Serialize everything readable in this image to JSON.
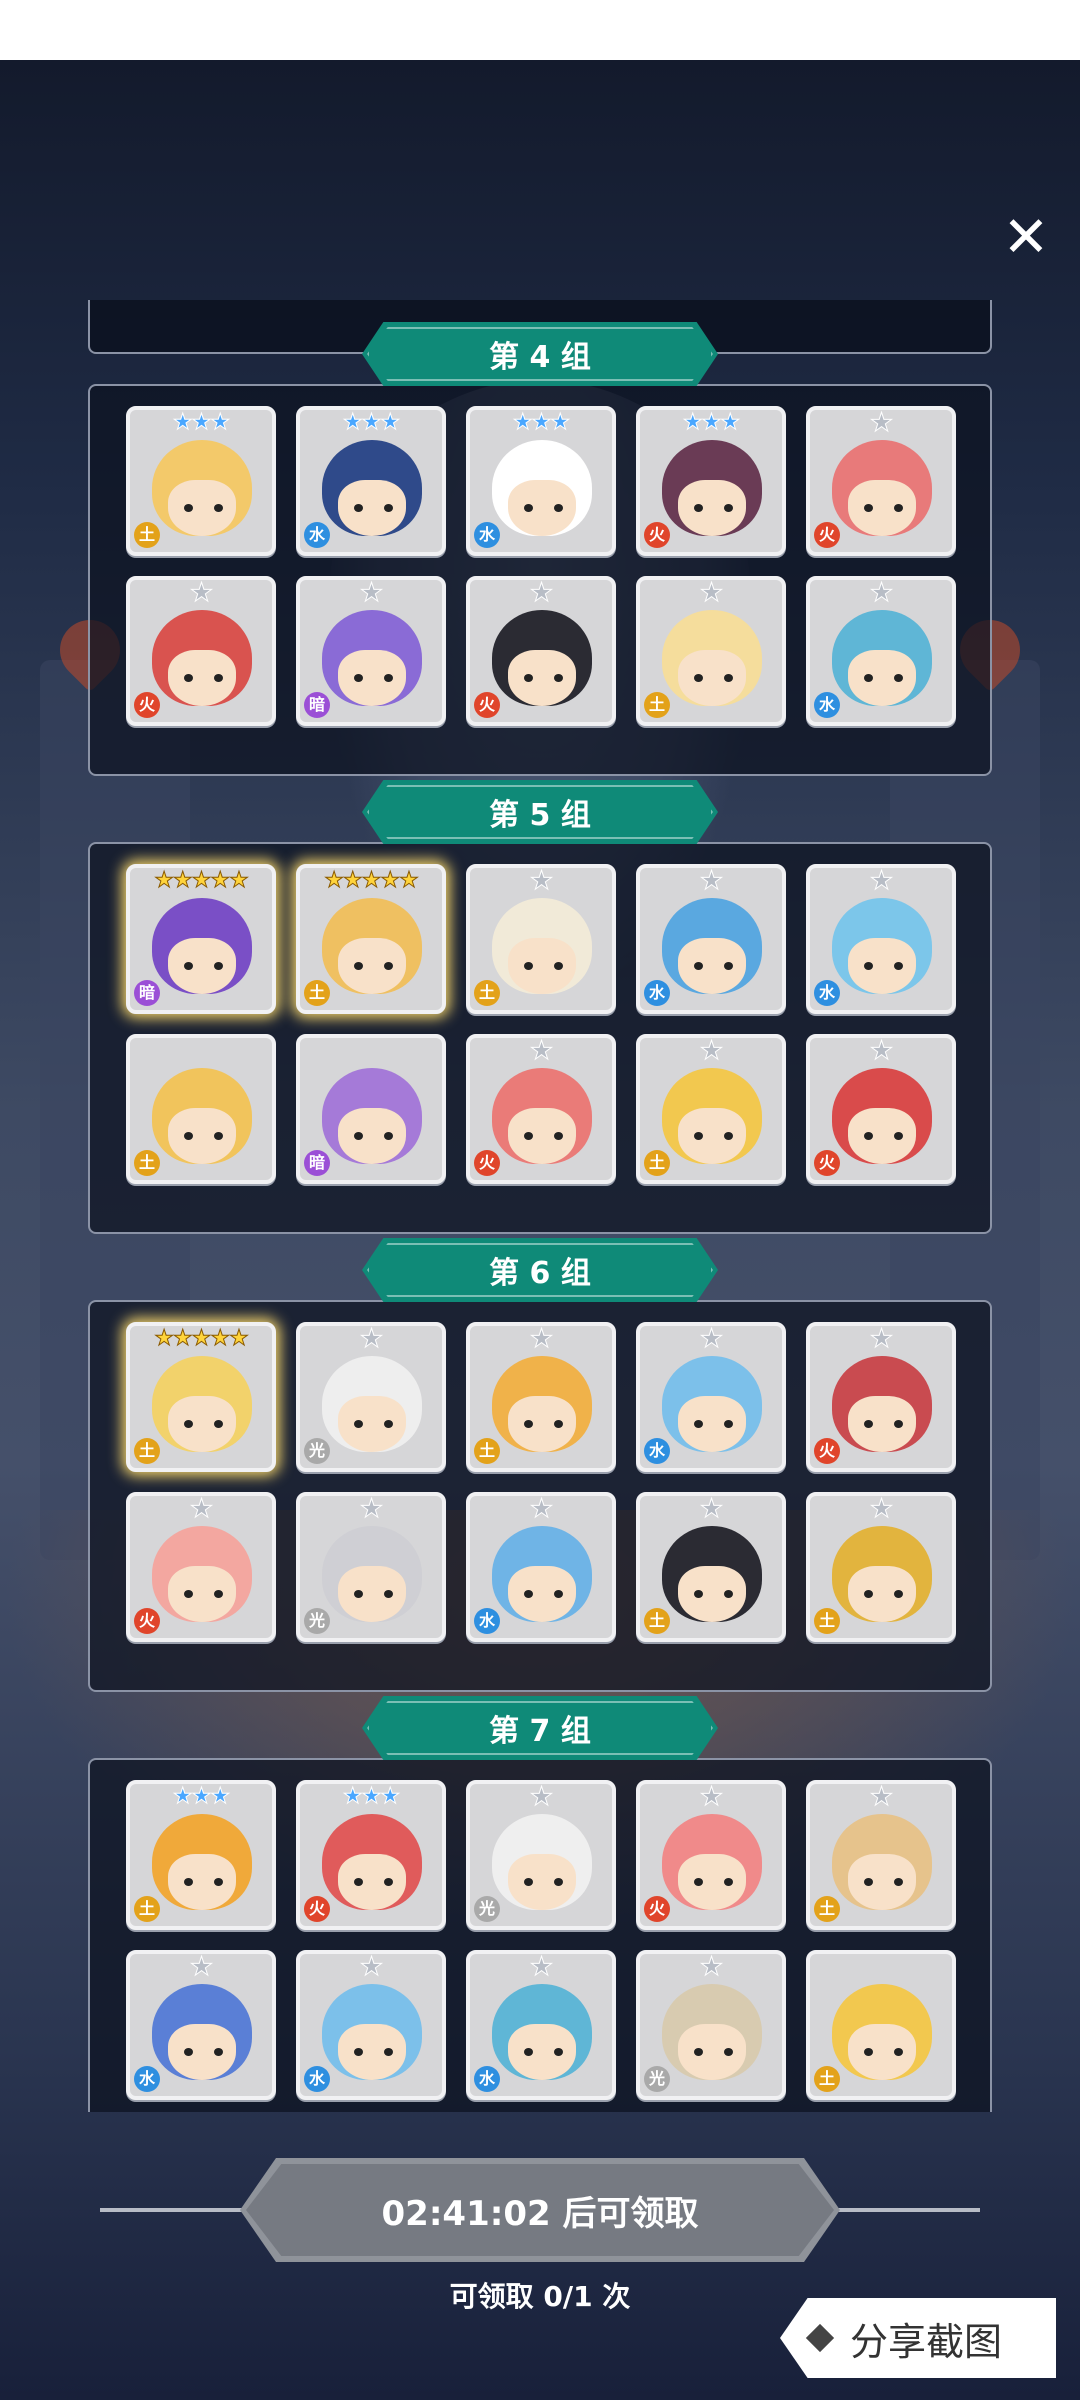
{
  "dialog": {
    "close_icon": "close-icon"
  },
  "groups": [
    {
      "title": "第 4 组",
      "heroes": [
        {
          "stars": "★★★",
          "star_type": "blue",
          "element": "earth",
          "head": "#f3c96a"
        },
        {
          "stars": "★★★",
          "star_type": "blue",
          "element": "water",
          "head": "#2f4a8a"
        },
        {
          "stars": "★★★",
          "star_type": "blue",
          "element": "water",
          "head": "#ffffff"
        },
        {
          "stars": "★★★",
          "star_type": "blue",
          "element": "fire",
          "head": "#6a3b55"
        },
        {
          "stars": "★",
          "star_type": "gray",
          "element": "fire",
          "head": "#e87a7a"
        },
        {
          "stars": "★",
          "star_type": "gray",
          "element": "fire",
          "head": "#d9534f"
        },
        {
          "stars": "★",
          "star_type": "gray",
          "element": "dark",
          "head": "#8a6bd6"
        },
        {
          "stars": "★",
          "star_type": "gray",
          "element": "fire",
          "head": "#2b2b33"
        },
        {
          "stars": "★",
          "star_type": "gray",
          "element": "earth",
          "head": "#f5dd9c"
        },
        {
          "stars": "★",
          "star_type": "gray",
          "element": "water",
          "head": "#5fb6d6"
        }
      ]
    },
    {
      "title": "第 5 组",
      "heroes": [
        {
          "stars": "★★★★★",
          "star_type": "gold",
          "element": "dark",
          "head": "#7a4fc6",
          "glow": true
        },
        {
          "stars": "★★★★★",
          "star_type": "gold",
          "element": "earth",
          "head": "#efc061",
          "glow": true
        },
        {
          "stars": "★",
          "star_type": "gray",
          "element": "earth",
          "head": "#f1ead8"
        },
        {
          "stars": "★",
          "star_type": "gray",
          "element": "water",
          "head": "#5aa8e0"
        },
        {
          "stars": "★",
          "star_type": "gray",
          "element": "water",
          "head": "#7cc6ea"
        },
        {
          "stars": "",
          "star_type": "gray",
          "element": "earth",
          "head": "#f1c45c"
        },
        {
          "stars": "",
          "star_type": "gray",
          "element": "dark",
          "head": "#a57ad8"
        },
        {
          "stars": "★",
          "star_type": "gray",
          "element": "fire",
          "head": "#ea7b78"
        },
        {
          "stars": "★",
          "star_type": "gray",
          "element": "earth",
          "head": "#f2c84f"
        },
        {
          "stars": "★",
          "star_type": "gray",
          "element": "fire",
          "head": "#d94b4b"
        }
      ]
    },
    {
      "title": "第 6 组",
      "heroes": [
        {
          "stars": "★★★★★",
          "star_type": "gold",
          "element": "earth",
          "head": "#f2d26b",
          "glow": true
        },
        {
          "stars": "★",
          "star_type": "gray",
          "element": "light",
          "head": "#eeeeee"
        },
        {
          "stars": "★",
          "star_type": "gray",
          "element": "earth",
          "head": "#f0b24a"
        },
        {
          "stars": "★",
          "star_type": "gray",
          "element": "water",
          "head": "#7cc0ea"
        },
        {
          "stars": "★",
          "star_type": "gray",
          "element": "fire",
          "head": "#c94b50"
        },
        {
          "stars": "★",
          "star_type": "gray",
          "element": "fire",
          "head": "#f3a7a0"
        },
        {
          "stars": "★",
          "star_type": "gray",
          "element": "light",
          "head": "#cfcfd4"
        },
        {
          "stars": "★",
          "star_type": "gray",
          "element": "water",
          "head": "#6fb4e6"
        },
        {
          "stars": "★",
          "star_type": "gray",
          "element": "earth",
          "head": "#2b2b33"
        },
        {
          "stars": "★",
          "star_type": "gray",
          "element": "earth",
          "head": "#e2b43e"
        }
      ]
    },
    {
      "title": "第 7 组",
      "heroes": [
        {
          "stars": "★★★",
          "star_type": "blue",
          "element": "earth",
          "head": "#f0a93a"
        },
        {
          "stars": "★★★",
          "star_type": "blue",
          "element": "fire",
          "head": "#e05b5b"
        },
        {
          "stars": "★",
          "star_type": "gray",
          "element": "light",
          "head": "#efefef"
        },
        {
          "stars": "★",
          "star_type": "gray",
          "element": "fire",
          "head": "#f08a8a"
        },
        {
          "stars": "★",
          "star_type": "gray",
          "element": "earth",
          "head": "#e6c38c"
        },
        {
          "stars": "★",
          "star_type": "gray",
          "element": "water",
          "head": "#5a7fd6"
        },
        {
          "stars": "★",
          "star_type": "gray",
          "element": "water",
          "head": "#7cc0ea"
        },
        {
          "stars": "★",
          "star_type": "gray",
          "element": "water",
          "head": "#5fb6d6"
        },
        {
          "stars": "★",
          "star_type": "gray",
          "element": "light",
          "head": "#d8cbb0"
        },
        {
          "stars": "",
          "star_type": "gray",
          "element": "earth",
          "head": "#f2c84f"
        }
      ]
    }
  ],
  "elements": {
    "fire": {
      "color": "#e0452b",
      "glyph": "火"
    },
    "water": {
      "color": "#2e8fe0",
      "glyph": "水"
    },
    "earth": {
      "color": "#e3a21a",
      "glyph": "土"
    },
    "dark": {
      "color": "#9b4fd6",
      "glyph": "暗"
    },
    "light": {
      "color": "#a9a9a9",
      "glyph": "光"
    }
  },
  "footer": {
    "timer_text": "02:41:02 后可领取",
    "claim_text": "可领取 0/1 次",
    "share_label": "分享截图"
  }
}
